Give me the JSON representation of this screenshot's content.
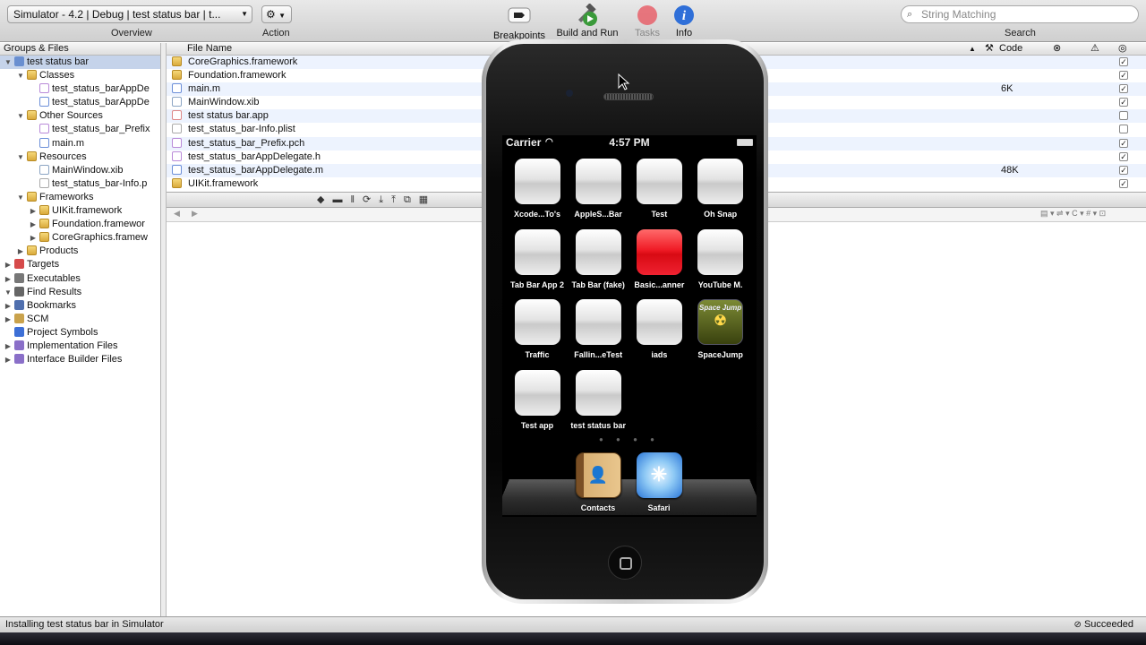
{
  "toolbar": {
    "scheme_popup": "Simulator - 4.2 | Debug | test status bar | t...",
    "overview_label": "Overview",
    "action_label": "Action",
    "breakpoints_label": "Breakpoints",
    "build_run_label": "Build and Run",
    "tasks_label": "Tasks",
    "info_label": "Info",
    "search_placeholder": "String Matching",
    "search_label": "Search"
  },
  "sidebar": {
    "header": "Groups & Files",
    "items": [
      {
        "label": "test status bar",
        "indent": 0,
        "expand": "▼",
        "kind": "project",
        "selected": true
      },
      {
        "label": "Classes",
        "indent": 1,
        "expand": "▼",
        "kind": "folder"
      },
      {
        "label": "test_status_barAppDe",
        "indent": 2,
        "expand": "",
        "kind": "h"
      },
      {
        "label": "test_status_barAppDe",
        "indent": 2,
        "expand": "",
        "kind": "m"
      },
      {
        "label": "Other Sources",
        "indent": 1,
        "expand": "▼",
        "kind": "folder"
      },
      {
        "label": "test_status_bar_Prefix",
        "indent": 2,
        "expand": "",
        "kind": "h"
      },
      {
        "label": "main.m",
        "indent": 2,
        "expand": "",
        "kind": "m"
      },
      {
        "label": "Resources",
        "indent": 1,
        "expand": "▼",
        "kind": "folder"
      },
      {
        "label": "MainWindow.xib",
        "indent": 2,
        "expand": "",
        "kind": "xib"
      },
      {
        "label": "test_status_bar-Info.p",
        "indent": 2,
        "expand": "",
        "kind": "plist"
      },
      {
        "label": "Frameworks",
        "indent": 1,
        "expand": "▼",
        "kind": "folder"
      },
      {
        "label": "UIKit.framework",
        "indent": 2,
        "expand": "▶",
        "kind": "framework"
      },
      {
        "label": "Foundation.framewor",
        "indent": 2,
        "expand": "▶",
        "kind": "framework"
      },
      {
        "label": "CoreGraphics.framew",
        "indent": 2,
        "expand": "▶",
        "kind": "framework"
      },
      {
        "label": "Products",
        "indent": 1,
        "expand": "▶",
        "kind": "folder"
      },
      {
        "label": "Targets",
        "indent": 0,
        "expand": "▶",
        "kind": "target"
      },
      {
        "label": "Executables",
        "indent": 0,
        "expand": "▶",
        "kind": "exec"
      },
      {
        "label": "Find Results",
        "indent": 0,
        "expand": "▼",
        "kind": "find"
      },
      {
        "label": "Bookmarks",
        "indent": 0,
        "expand": "▶",
        "kind": "bookmark"
      },
      {
        "label": "SCM",
        "indent": 0,
        "expand": "▶",
        "kind": "scm"
      },
      {
        "label": "Project Symbols",
        "indent": 0,
        "expand": "",
        "kind": "symbols"
      },
      {
        "label": "Implementation Files",
        "indent": 0,
        "expand": "▶",
        "kind": "smart"
      },
      {
        "label": "Interface Builder Files",
        "indent": 0,
        "expand": "▶",
        "kind": "smart"
      }
    ]
  },
  "filelist": {
    "col_name": "File Name",
    "col_code": "Code",
    "files": [
      {
        "name": "CoreGraphics.framework",
        "code": "",
        "checked": true,
        "kind": "framework"
      },
      {
        "name": "Foundation.framework",
        "code": "",
        "checked": true,
        "kind": "framework"
      },
      {
        "name": "main.m",
        "code": "6K",
        "checked": true,
        "kind": "m"
      },
      {
        "name": "MainWindow.xib",
        "code": "",
        "checked": true,
        "kind": "xib"
      },
      {
        "name": "test status bar.app",
        "code": "",
        "checked": false,
        "kind": "app"
      },
      {
        "name": "test_status_bar-Info.plist",
        "code": "",
        "checked": false,
        "kind": "plist"
      },
      {
        "name": "test_status_bar_Prefix.pch",
        "code": "",
        "checked": true,
        "kind": "h"
      },
      {
        "name": "test_status_barAppDelegate.h",
        "code": "",
        "checked": true,
        "kind": "h"
      },
      {
        "name": "test_status_barAppDelegate.m",
        "code": "48K",
        "checked": true,
        "kind": "m"
      },
      {
        "name": "UIKit.framework",
        "code": "",
        "checked": true,
        "kind": "framework"
      }
    ]
  },
  "status": {
    "message": "Installing test status bar in Simulator",
    "result": "Succeeded"
  },
  "simulator": {
    "carrier": "Carrier",
    "time": "4:57 PM",
    "apps": [
      {
        "name": "Xcode...To's",
        "style": "plain"
      },
      {
        "name": "AppleS...Bar",
        "style": "plain"
      },
      {
        "name": "Test",
        "style": "plain"
      },
      {
        "name": "Oh Snap",
        "style": "plain"
      },
      {
        "name": "Tab Bar App 2",
        "style": "plain"
      },
      {
        "name": "Tab Bar (fake)",
        "style": "plain"
      },
      {
        "name": "Basic...anner",
        "style": "red"
      },
      {
        "name": "YouTube M.",
        "style": "plain"
      },
      {
        "name": "Traffic",
        "style": "plain"
      },
      {
        "name": "Fallin...eTest",
        "style": "plain"
      },
      {
        "name": "iads",
        "style": "plain"
      },
      {
        "name": "SpaceJump",
        "style": "space",
        "icon_text": "Space Jump"
      },
      {
        "name": "Test app",
        "style": "plain"
      },
      {
        "name": "test status bar",
        "style": "plain"
      }
    ],
    "page_dots": "● ● ● ●",
    "dock": [
      {
        "name": "Contacts",
        "style": "contacts"
      },
      {
        "name": "Safari",
        "style": "safari"
      }
    ]
  },
  "colors": {
    "accent": "#c5d3ea",
    "build_run_green": "#3a9a3a",
    "tasks_red": "#e8505b",
    "info_blue": "#2f6fd8"
  }
}
